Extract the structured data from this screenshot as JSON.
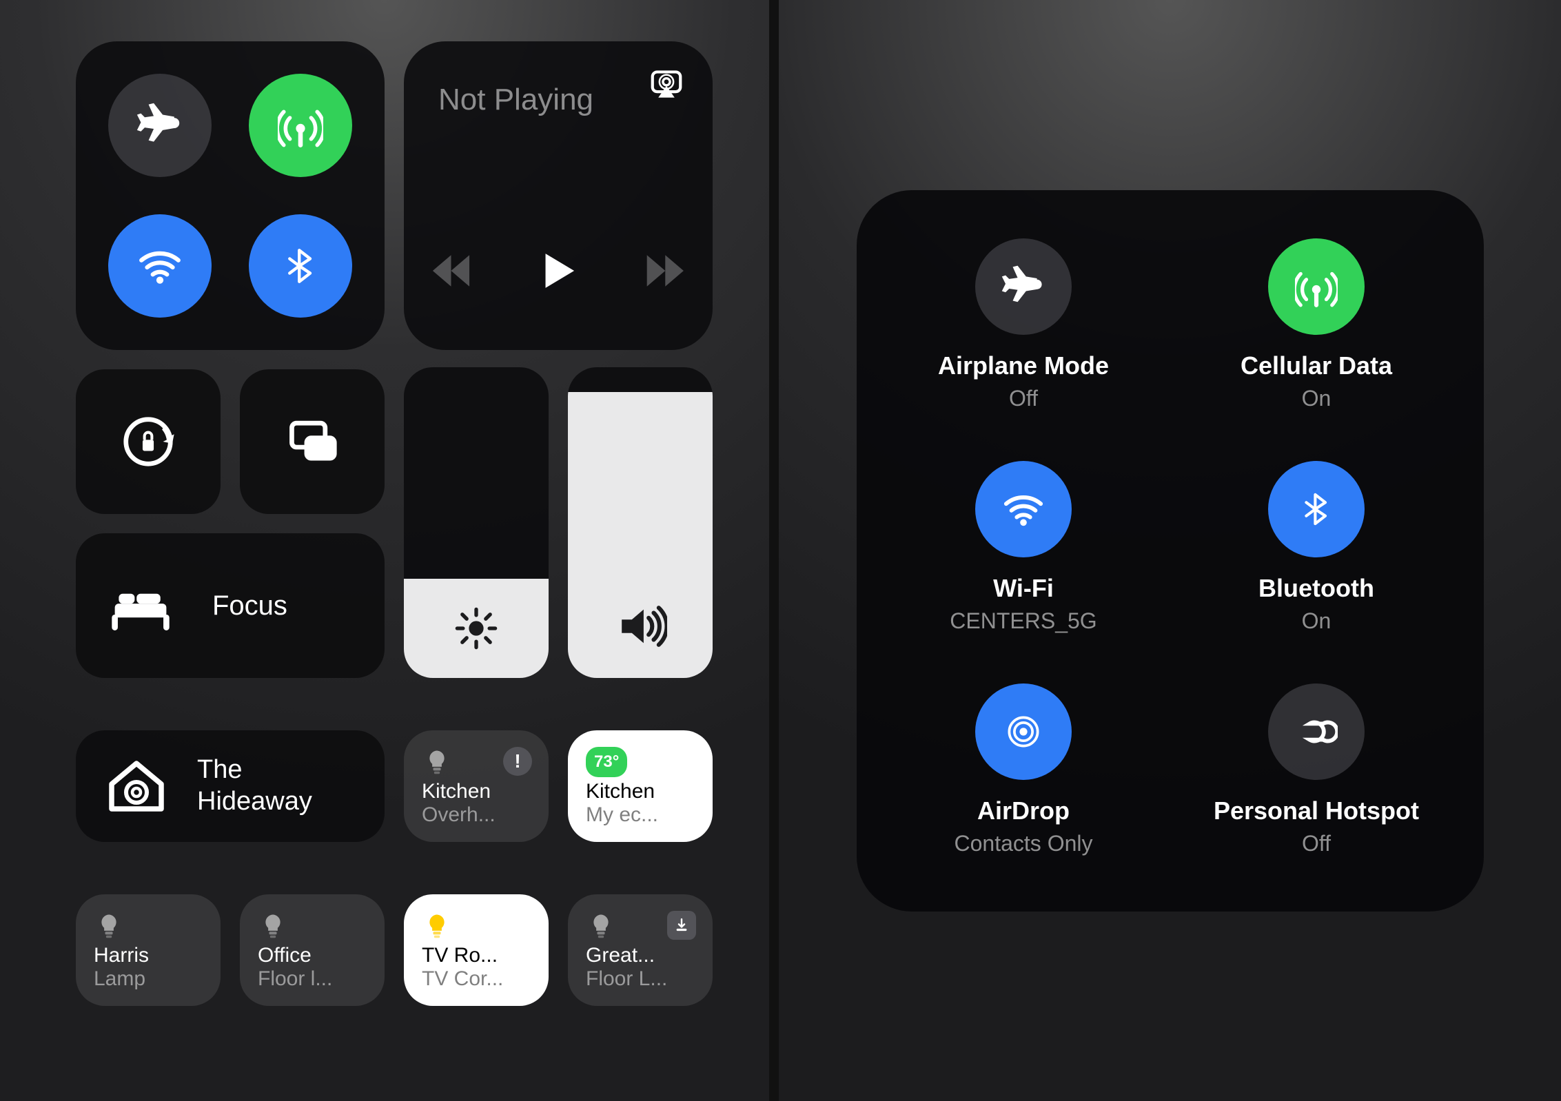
{
  "media": {
    "now_playing": "Not Playing"
  },
  "focus": {
    "label": "Focus"
  },
  "sliders": {
    "brightness_pct": 32,
    "volume_pct": 92
  },
  "home": {
    "name_line1": "The",
    "name_line2": "Hideaway"
  },
  "home_tiles": {
    "kitchen_overhead": {
      "title": "Kitchen",
      "sub": "Overh..."
    },
    "kitchen_ecobee": {
      "title": "Kitchen",
      "sub": "My ec...",
      "temp": "73°"
    },
    "harris": {
      "title": "Harris",
      "sub": "Lamp"
    },
    "office": {
      "title": "Office",
      "sub": "Floor l..."
    },
    "tvroom": {
      "title": "TV Ro...",
      "sub": "TV Cor..."
    },
    "great": {
      "title": "Great...",
      "sub": "Floor L..."
    }
  },
  "expanded": {
    "airplane": {
      "title": "Airplane Mode",
      "status": "Off",
      "on": false
    },
    "cellular": {
      "title": "Cellular Data",
      "status": "On",
      "on": true
    },
    "wifi": {
      "title": "Wi-Fi",
      "status": "CENTERS_5G",
      "on": true
    },
    "bluetooth": {
      "title": "Bluetooth",
      "status": "On",
      "on": true
    },
    "airdrop": {
      "title": "AirDrop",
      "status": "Contacts Only",
      "on": true
    },
    "hotspot": {
      "title": "Personal Hotspot",
      "status": "Off",
      "on": false
    }
  }
}
